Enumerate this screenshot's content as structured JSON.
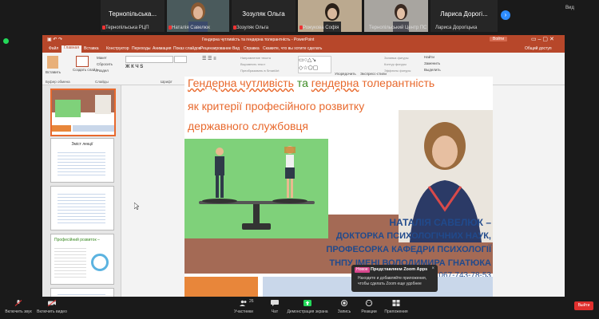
{
  "gallery": {
    "tiles": [
      {
        "name": "Тернопільська РЦП",
        "type": "name"
      },
      {
        "name": "Наталія Савелюк",
        "type": "video"
      },
      {
        "name": "Зозуляк Ольга",
        "type": "name"
      },
      {
        "name": "Рожукова Софія",
        "type": "video"
      },
      {
        "name": "Тернопільський Центр ПС",
        "type": "video"
      },
      {
        "name": "Лариса Дорогіцька",
        "type": "name"
      }
    ],
    "big_names": [
      "Тернопільська...",
      "Зозуляк Ольга",
      "Лариса Дорогі..."
    ],
    "next_glyph": "›",
    "view_label": "Вид"
  },
  "ppt": {
    "title": "Гендерна чутливість та гендерна толерантність - PowerPoint",
    "sign_in": "Войти",
    "tabs": [
      "Файл",
      "Главная",
      "Вставка",
      "Конструктор",
      "Переходы",
      "Анимация",
      "Показ слайдов",
      "Рецензирование",
      "Вид",
      "Справка"
    ],
    "tell_me": "Скажите, что вы хотите сделать",
    "share": "Общий доступ",
    "groups": [
      "Буфер обмена",
      "Слайды",
      "Шрифт",
      "Абзац",
      "Рисование",
      "Редактирование"
    ],
    "ribbon_labels": {
      "paste": "Вставить",
      "new_slide": "Создать слайд",
      "layout": "Макет",
      "reset": "Сбросить",
      "section": "Раздел",
      "find": "Найти",
      "replace": "Заменить",
      "select": "Выделить",
      "arrange": "Упорядочить",
      "styles": "Экспресс-стили"
    },
    "thumbs": [
      {
        "num": "1"
      },
      {
        "num": "2",
        "title": "Зміст лекції"
      },
      {
        "num": "3"
      },
      {
        "num": "4",
        "title": "Професійний розвиток –"
      },
      {
        "num": "5"
      }
    ]
  },
  "slide": {
    "title_parts": [
      {
        "text": "Гендерна",
        "cls": "t-orange"
      },
      {
        "text": " чутливість",
        "cls": "t-orange"
      },
      {
        "text": " та ",
        "cls": "t-green"
      },
      {
        "text": "гендерна",
        "cls": "t-orange"
      },
      {
        "text": " толерантність",
        "cls": "t-orange"
      }
    ],
    "line2": "як критерії професійного розвитку",
    "line3": "державного службовця",
    "name_lines": [
      "НАТАЛІЯ САВЕЛЮК –",
      "ДОКТОРКА ПСИХОЛОГІЧНИХ НАУК,",
      "ПРОФЕСОРКА КАФЕДРИ ПСИХОЛОГІЇ",
      "ТНПУ ІМЕНІ ВОЛОДИМИРА ГНАТЮКА"
    ],
    "phone": "067-743-78-53"
  },
  "popup": {
    "badge": "Новое",
    "title": "Представляем Zoom Apps",
    "desc": "Находите и добавляйте приложения, чтобы сделать Zoom еще удобнее",
    "close": "×"
  },
  "toolbar": {
    "mic": "Включить звук",
    "video": "Включить видео",
    "participants": "Участники",
    "participants_count": "26",
    "chat": "Чат",
    "share": "Демонстрация экрана",
    "record": "Запись",
    "reactions": "Реакции",
    "apps": "Приложения",
    "leave": "Выйти"
  },
  "colors": {
    "ppt_red": "#b7472a",
    "zoom_green": "#23d959",
    "leave_red": "#e0302e"
  }
}
